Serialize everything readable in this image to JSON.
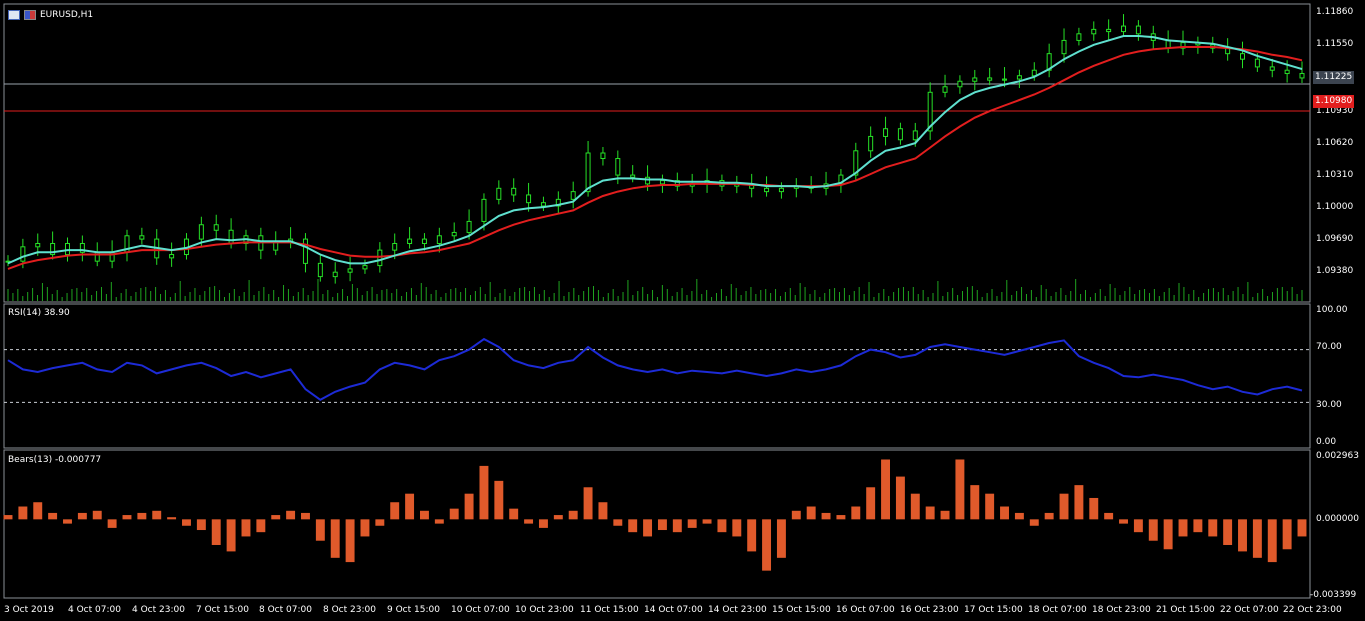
{
  "symbol": "EURUSD,H1",
  "colors": {
    "candle": "#26e026",
    "volume": "#1fa31f",
    "ma_fast": "#5fe0cf",
    "ma_slow": "#e21e1e",
    "rsi": "#1d2bd6",
    "bears": "#e05a2b",
    "grid": "#9aa3ad",
    "level": "#e21e1e",
    "bid_tag_bg": "#3c4450",
    "level_tag_bg": "#e21e1e"
  },
  "price_axis": {
    "ticks": [
      "1.11860",
      "1.11550",
      "1.11225",
      "1.10930",
      "1.10620",
      "1.10310",
      "1.10000",
      "1.09690",
      "1.09380"
    ],
    "bid_label": "1.11225",
    "level_label": "1.10980"
  },
  "rsi": {
    "label": "RSI(14) 38.90",
    "ticks": [
      "100.00",
      "70.00",
      "30.00",
      "0.00"
    ]
  },
  "bears": {
    "label": "Bears(13) -0.000777",
    "ticks": [
      "0.002963",
      "0.000000",
      "-0.003399"
    ]
  },
  "time_axis": [
    "3 Oct 2019",
    "4 Oct 07:00",
    "4 Oct 23:00",
    "7 Oct 15:00",
    "8 Oct 07:00",
    "8 Oct 23:00",
    "9 Oct 15:00",
    "10 Oct 07:00",
    "10 Oct 23:00",
    "11 Oct 15:00",
    "14 Oct 07:00",
    "14 Oct 23:00",
    "15 Oct 15:00",
    "16 Oct 07:00",
    "16 Oct 23:00",
    "17 Oct 15:00",
    "18 Oct 07:00",
    "18 Oct 23:00",
    "21 Oct 15:00",
    "22 Oct 07:00",
    "22 Oct 23:00"
  ],
  "chart_data": {
    "type": "line",
    "title": "EURUSD,H1",
    "ylim": [
      1.0925,
      1.1195
    ],
    "horizontal_levels": [
      1.11225,
      1.1098
    ],
    "series": [
      {
        "name": "",
        "values": [
          1.0962,
          1.0975,
          1.0978,
          1.0968,
          1.0978,
          1.097,
          1.0962,
          1.097,
          1.0985,
          1.0982,
          1.0965,
          1.0968,
          1.0982,
          1.0995,
          1.099,
          1.0978,
          1.0985,
          1.0972,
          1.098,
          1.0982,
          1.096,
          1.0948,
          1.0952,
          1.0955,
          1.0958,
          1.0972,
          1.0978,
          1.0982,
          1.0978,
          1.0985,
          1.0988,
          1.0998,
          1.1018,
          1.1028,
          1.1022,
          1.1015,
          1.1012,
          1.1018,
          1.1025,
          1.106,
          1.1055,
          1.104,
          1.1038,
          1.1032,
          1.1035,
          1.103,
          1.1032,
          1.1035,
          1.103,
          1.1032,
          1.1028,
          1.1025,
          1.1028,
          1.103,
          1.1028,
          1.1032,
          1.104,
          1.1062,
          1.1075,
          1.1082,
          1.1072,
          1.108,
          1.1115,
          1.112,
          1.1125,
          1.1128,
          1.1126,
          1.1127,
          1.113,
          1.1135,
          1.115,
          1.1162,
          1.1168,
          1.1172,
          1.117,
          1.1175,
          1.1168,
          1.1162,
          1.1155,
          1.116,
          1.1158,
          1.1155,
          1.115,
          1.1145,
          1.1138,
          1.1135,
          1.1132,
          1.1128
        ]
      },
      {
        "name": "",
        "values": [
          1.096,
          1.0966,
          1.097,
          1.097,
          1.0972,
          1.0972,
          1.097,
          1.097,
          1.0973,
          1.0976,
          1.0974,
          1.0972,
          1.0974,
          1.0979,
          1.0982,
          1.0981,
          1.0982,
          1.098,
          1.098,
          1.098,
          1.0975,
          1.0968,
          1.0963,
          1.096,
          1.096,
          1.0963,
          1.0967,
          1.0971,
          1.0973,
          1.0976,
          1.098,
          1.0985,
          1.0994,
          1.1003,
          1.1008,
          1.101,
          1.1011,
          1.1013,
          1.1016,
          1.1028,
          1.1035,
          1.1037,
          1.1037,
          1.1036,
          1.1036,
          1.1034,
          1.1034,
          1.1034,
          1.1033,
          1.1033,
          1.1032,
          1.103,
          1.103,
          1.103,
          1.1029,
          1.103,
          1.1033,
          1.1042,
          1.1053,
          1.1062,
          1.1065,
          1.1069,
          1.1084,
          1.1097,
          1.1108,
          1.1115,
          1.1119,
          1.1122,
          1.1125,
          1.1129,
          1.1136,
          1.1145,
          1.1152,
          1.1158,
          1.1162,
          1.1166,
          1.1166,
          1.1165,
          1.1162,
          1.1161,
          1.116,
          1.1159,
          1.1156,
          1.1153,
          1.1148,
          1.1144,
          1.114,
          1.1136
        ]
      },
      {
        "name": "",
        "values": [
          1.0955,
          1.096,
          1.0963,
          1.0965,
          1.0967,
          1.0968,
          1.0968,
          1.0968,
          1.097,
          1.0972,
          1.0972,
          1.0972,
          1.0973,
          1.0975,
          1.0977,
          1.0978,
          1.0979,
          1.0979,
          1.0979,
          1.0979,
          1.0977,
          1.0973,
          1.097,
          1.0967,
          1.0966,
          1.0966,
          1.0967,
          1.0969,
          1.097,
          1.0972,
          1.0975,
          1.0978,
          1.0984,
          1.099,
          1.0995,
          1.0999,
          1.1002,
          1.1005,
          1.1008,
          1.1015,
          1.1021,
          1.1025,
          1.1028,
          1.103,
          1.1031,
          1.1031,
          1.1032,
          1.1032,
          1.1032,
          1.1032,
          1.1031,
          1.1031,
          1.103,
          1.103,
          1.103,
          1.103,
          1.1031,
          1.1035,
          1.1041,
          1.1047,
          1.1051,
          1.1055,
          1.1065,
          1.1075,
          1.1084,
          1.1092,
          1.1098,
          1.1103,
          1.1108,
          1.1113,
          1.1119,
          1.1126,
          1.1133,
          1.1139,
          1.1144,
          1.1149,
          1.1152,
          1.1154,
          1.1155,
          1.1156,
          1.1156,
          1.1156,
          1.1155,
          1.1154,
          1.1152,
          1.1149,
          1.1147,
          1.1144
        ]
      }
    ],
    "rsi_values": [
      62,
      55,
      53,
      56,
      58,
      60,
      55,
      53,
      60,
      58,
      52,
      55,
      58,
      60,
      56,
      50,
      53,
      49,
      52,
      55,
      40,
      32,
      38,
      42,
      45,
      55,
      60,
      58,
      55,
      62,
      65,
      70,
      78,
      72,
      62,
      58,
      56,
      60,
      62,
      72,
      64,
      58,
      55,
      53,
      55,
      52,
      54,
      53,
      52,
      54,
      52,
      50,
      52,
      55,
      53,
      55,
      58,
      65,
      70,
      68,
      64,
      66,
      72,
      74,
      72,
      70,
      68,
      66,
      69,
      72,
      75,
      77,
      65,
      60,
      56,
      50,
      49,
      51,
      49,
      47,
      43,
      40,
      42,
      38,
      36,
      40,
      42,
      39
    ],
    "rsi_ylim": [
      0,
      100
    ],
    "rsi_levels": [
      70,
      30
    ],
    "bears_values": [
      0.0002,
      0.0006,
      0.0008,
      0.0003,
      -0.0002,
      0.0003,
      0.0004,
      -0.0004,
      0.0002,
      0.0003,
      0.0004,
      0.0001,
      -0.0003,
      -0.0005,
      -0.0012,
      -0.0015,
      -0.0008,
      -0.0006,
      0.0002,
      0.0004,
      0.0003,
      -0.001,
      -0.0018,
      -0.002,
      -0.0008,
      -0.0003,
      0.0008,
      0.0012,
      0.0004,
      -0.0002,
      0.0005,
      0.0012,
      0.0025,
      0.0018,
      0.0005,
      -0.0002,
      -0.0004,
      0.0002,
      0.0004,
      0.0015,
      0.0008,
      -0.0003,
      -0.0006,
      -0.0008,
      -0.0005,
      -0.0006,
      -0.0004,
      -0.0002,
      -0.0006,
      -0.0008,
      -0.0015,
      -0.0024,
      -0.0018,
      0.0004,
      0.0006,
      0.0003,
      0.0002,
      0.0006,
      0.0015,
      0.0028,
      0.002,
      0.0012,
      0.0006,
      0.0004,
      0.0028,
      0.0016,
      0.0012,
      0.0006,
      0.0003,
      -0.0003,
      0.0003,
      0.0012,
      0.0016,
      0.001,
      0.0003,
      -0.0002,
      -0.0006,
      -0.001,
      -0.0014,
      -0.0008,
      -0.0006,
      -0.0008,
      -0.0012,
      -0.0015,
      -0.0018,
      -0.002,
      -0.0014,
      -0.0008
    ],
    "bears_ylim": [
      -0.003399,
      0.002963
    ]
  }
}
